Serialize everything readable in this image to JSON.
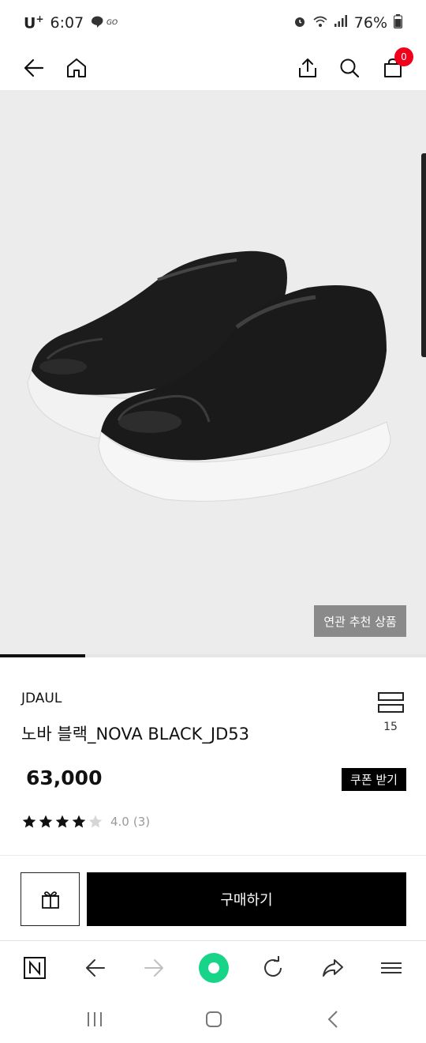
{
  "status_bar": {
    "carrier": "U",
    "carrier_sup": "+",
    "time": "6:07",
    "battery": "76%"
  },
  "header": {
    "cart_count": "0"
  },
  "hero": {
    "related_button": "연관 추천 상품",
    "slide_progress": 0.2
  },
  "product": {
    "brand": "JDAUL",
    "name": "노바 블랙_NOVA BLACK_JD53",
    "list_count": "15",
    "price": "63,000",
    "coupon_button": "쿠폰 받기",
    "rating_value": 4,
    "rating_max": 5,
    "rating_text": "4.0",
    "review_count": "(3)"
  },
  "actions": {
    "buy_button": "구매하기"
  },
  "colors": {
    "accent_green": "#17d488",
    "badge_red": "#f0001a"
  },
  "icons": [
    "back-arrow-icon",
    "home-icon",
    "share-icon",
    "search-icon",
    "cart-icon",
    "list-view-icon",
    "gift-icon",
    "naver-n-icon",
    "browser-back-icon",
    "browser-forward-icon",
    "browser-home-icon",
    "refresh-icon",
    "share-arrow-icon",
    "menu-icon",
    "recent-apps-icon",
    "home-button-icon",
    "system-back-icon"
  ]
}
